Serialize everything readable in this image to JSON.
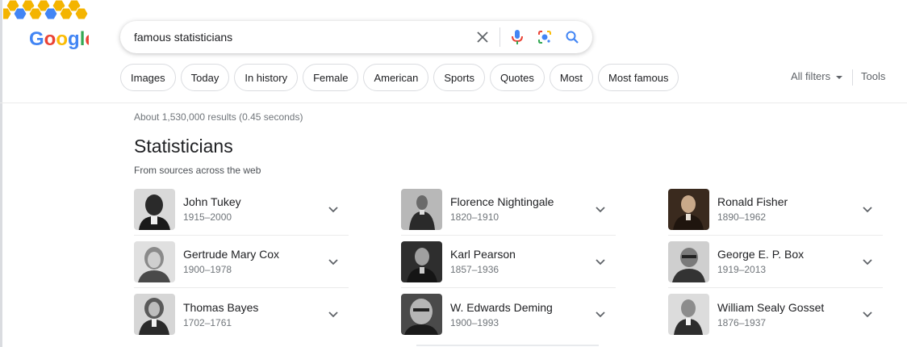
{
  "logo": {
    "text": "Google",
    "colors": [
      "#4285F4",
      "#EA4335",
      "#FBBC05",
      "#4285F4",
      "#34A853",
      "#EA4335"
    ],
    "doodle_color": "#F4B400"
  },
  "search": {
    "query": "famous statisticians"
  },
  "icons": {
    "clear": "close-icon",
    "voice": "microphone-icon",
    "lens": "camera-lens-icon",
    "submit": "search-icon"
  },
  "chips": [
    "Images",
    "Today",
    "In history",
    "Female",
    "American",
    "Sports",
    "Quotes",
    "Most",
    "Most famous"
  ],
  "toolbar": {
    "all_filters": "All filters",
    "tools": "Tools"
  },
  "results": {
    "stats": "About 1,530,000 results (0.45 seconds)",
    "title": "Statisticians",
    "subtitle": "From sources across the web"
  },
  "entities": [
    {
      "name": "John Tukey",
      "dates": "1915–2000",
      "tone": "#2a2a2a"
    },
    {
      "name": "Florence Nightingale",
      "dates": "1820–1910",
      "tone": "#7a7a7a"
    },
    {
      "name": "Ronald Fisher",
      "dates": "1890–1962",
      "tone": "#4a3728"
    },
    {
      "name": "Gertrude Mary Cox",
      "dates": "1900–1978",
      "tone": "#9a9a9a"
    },
    {
      "name": "Karl Pearson",
      "dates": "1857–1936",
      "tone": "#3c3c3c"
    },
    {
      "name": "George E. P. Box",
      "dates": "1919–2013",
      "tone": "#5c5c5c"
    },
    {
      "name": "Thomas Bayes",
      "dates": "1702–1761",
      "tone": "#6b6b6b"
    },
    {
      "name": "W. Edwards Deming",
      "dates": "1900–1993",
      "tone": "#444444"
    },
    {
      "name": "William Sealy Gosset",
      "dates": "1876–1937",
      "tone": "#555555"
    }
  ]
}
